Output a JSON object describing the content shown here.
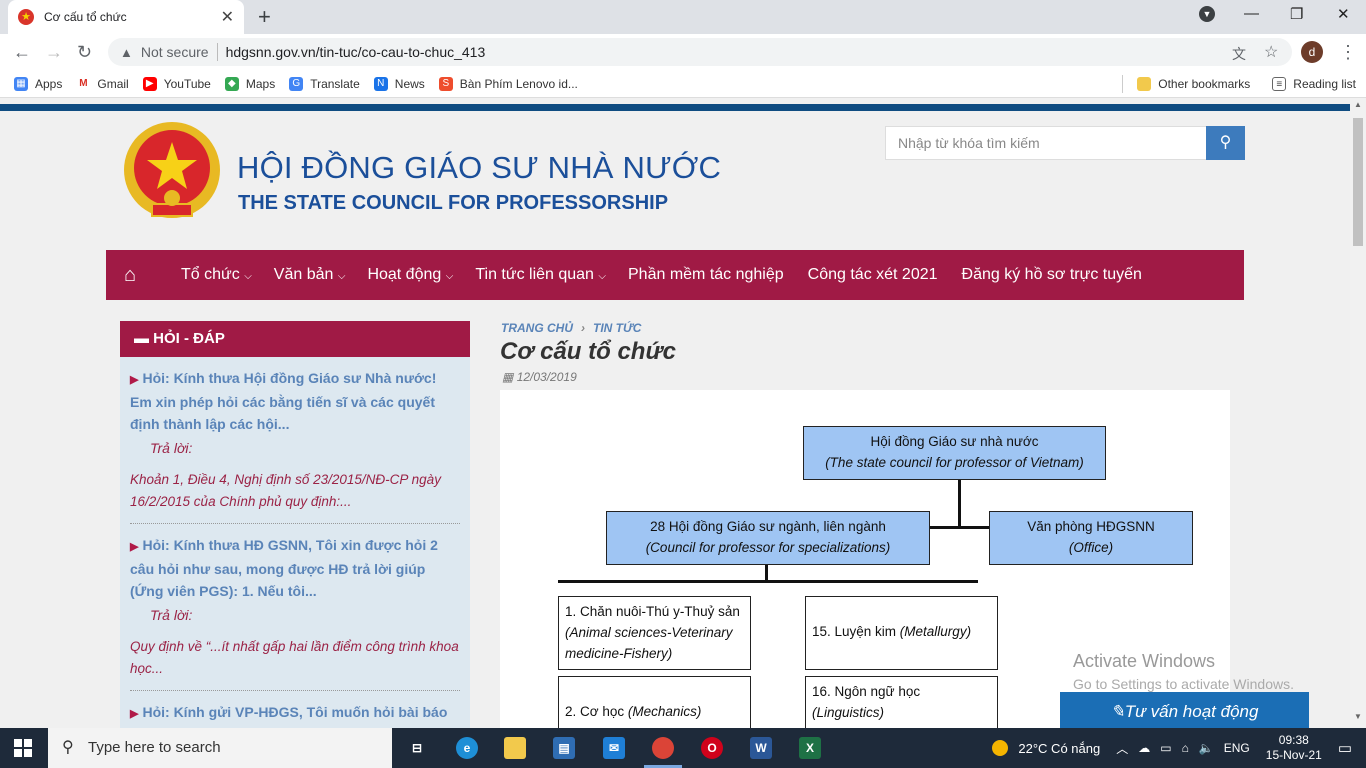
{
  "browser": {
    "tab_title": "Cơ cấu tổ chức",
    "new_tab": "+",
    "not_secure": "Not secure",
    "url": "hdgsnn.gov.vn/tin-tuc/co-cau-to-chuc_413",
    "avatar_letter": "d",
    "bookmarks": [
      "Apps",
      "Gmail",
      "YouTube",
      "Maps",
      "Translate",
      "News",
      "Bàn Phím Lenovo id..."
    ],
    "other_bookmarks": "Other bookmarks",
    "reading_list": "Reading list"
  },
  "site": {
    "title": "HỘI ĐỒNG GIÁO SƯ NHÀ NƯỚC",
    "subtitle": "THE STATE COUNCIL FOR PROFESSORSHIP",
    "search_placeholder": "Nhập từ khóa tìm kiếm",
    "menu": [
      "Tổ chức",
      "Văn bản",
      "Hoạt động",
      "Tin tức liên quan",
      "Phần mềm tác nghiệp",
      "Công tác xét 2021",
      "Đăng ký hồ sơ trực tuyến"
    ]
  },
  "sidebar": {
    "heading": "HỎI - ĐÁP",
    "answer_label": "Trả lời:",
    "items": [
      {
        "q": "Hỏi: Kính thưa Hội đồng Giáo sư Nhà nước! Em xin phép hỏi các bằng tiến sĩ và các quyết định thành lập các hội...",
        "a": "Khoản 1, Điều 4, Nghị định số 23/2015/NĐ-CP ngày 16/2/2015 của Chính phủ quy định:..."
      },
      {
        "q": "Hỏi: Kính thưa HĐ GSNN, Tôi xin được hỏi 2 câu hỏi như sau, mong được HĐ trả lời giúp (Ứng viên PGS): 1. Nếu tôi...",
        "a": "Quy định về “...ít nhất gấp hai lần điểm công trình khoa học..."
      },
      {
        "q": "Hỏi: Kính gửi VP-HĐGS, Tôi muốn hỏi bài báo ISI đã được chấp nhận, và online first trên web của tạp chí, nhưng...",
        "a": ""
      }
    ]
  },
  "article": {
    "crumb_home": "TRANG CHỦ",
    "crumb_section": "TIN TỨC",
    "title": "Cơ cấu tổ chức",
    "date": "12/03/2019",
    "org": {
      "top": {
        "vi": "Hội đồng Giáo sư nhà nước",
        "en": "(The state council for professor of Vietnam)"
      },
      "councils": {
        "vi": "28 Hội đồng Giáo sư ngành, liên ngành",
        "en": "(Council for professor for specializations)"
      },
      "office": {
        "vi": "Văn phòng HĐGSNN",
        "en": "(Office)"
      },
      "b1": {
        "vi": "1. Chăn nuôi-Thú y-Thuỷ sản ",
        "en": "(Animal sciences-Veterinary medicine-Fishery)"
      },
      "b15": {
        "vi": "15. Luyện kim ",
        "en": "(Metallurgy)"
      },
      "b2": {
        "vi": "2. Cơ học ",
        "en": "(Mechanics)"
      },
      "b16": {
        "vi": "16. Ngôn ngữ học ",
        "en": "(Linguistics)"
      }
    }
  },
  "overlay": {
    "activate_title": "Activate Windows",
    "activate_sub": "Go to Settings to activate Windows.",
    "consult_button": "Tư vấn hoạt động"
  },
  "taskbar": {
    "search_placeholder": "Type here to search",
    "weather": "22°C  Có nắng",
    "lang": "ENG",
    "time": "09:38",
    "date": "15-Nov-21"
  }
}
